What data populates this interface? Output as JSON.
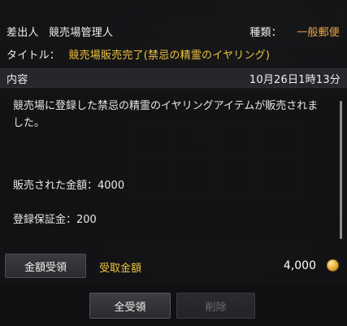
{
  "header": {
    "sender_label": "差出人",
    "sender_value": "競売場管理人",
    "type_label": "種類：",
    "type_value": "一般郵便",
    "title_label": "タイトル：",
    "title_value": "競売場販売完了(禁忌の精霊のイヤリング)"
  },
  "content": {
    "label": "内容",
    "date": "10月26日1時13分",
    "message": "競売場に登録した禁忌の精霊のイヤリングアイテムが販売されました。",
    "sold_line": "販売された金額：4000",
    "deposit_line": "登録保証金：200"
  },
  "claim": {
    "button_label": "金額受領",
    "receive_label": "受取金額",
    "amount": "4,000",
    "coin_icon": "gold-coin-icon"
  },
  "actions": {
    "claim_all_label": "全受領",
    "delete_label": "削除"
  },
  "colors": {
    "type_value": "#e7a740",
    "title_value": "#f0c33c",
    "receive_label": "#f0c33c",
    "disabled_text": "#6f6f72"
  }
}
